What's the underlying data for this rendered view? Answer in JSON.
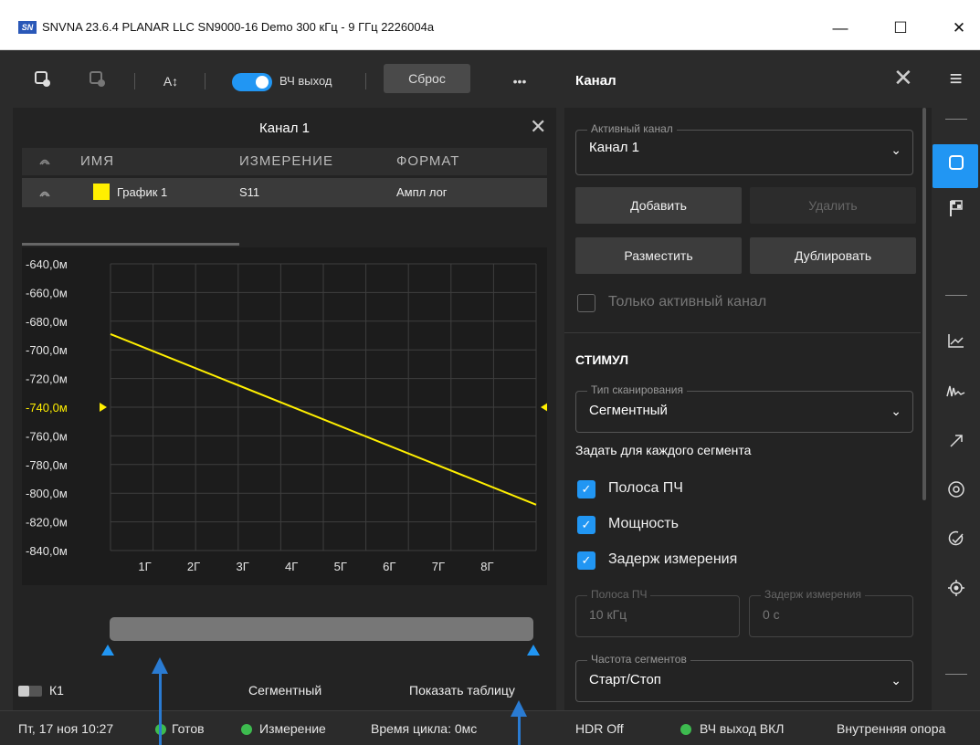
{
  "window": {
    "logo": "SN",
    "title": "SNVNA 23.6.4 PLANAR LLC SN9000-16 Demo 300 кГц - 9 ГГц 2226004a",
    "minimize": "—",
    "maximize": "☐",
    "close": "✕"
  },
  "toolbar": {
    "a_label": "A↕",
    "rf_out_label": "ВЧ выход",
    "reset_label": "Сброс",
    "more_label": "•••"
  },
  "channel_panel": {
    "title": "Канал 1",
    "close": "✕",
    "headers": [
      "ИМЯ",
      "ИЗМЕРЕНИЕ",
      "ФОРМАТ"
    ],
    "trace": {
      "name": "График 1",
      "measurement": "S11",
      "format": "Ампл лог",
      "color": "#ffef00"
    }
  },
  "chart_data": {
    "type": "line",
    "title": "",
    "xlabel": "",
    "ylabel": "",
    "y_tick_labels": [
      "-640,0м",
      "-660,0м",
      "-680,0м",
      "-700,0м",
      "-720,0м",
      "-740,0м",
      "-760,0м",
      "-780,0м",
      "-800,0м",
      "-820,0м",
      "-840,0м"
    ],
    "x_tick_labels": [
      "1Г",
      "2Г",
      "3Г",
      "4Г",
      "5Г",
      "6Г",
      "7Г",
      "8Г"
    ],
    "ylim": [
      -840,
      -640
    ],
    "reference_level": -740,
    "series": [
      {
        "color": "#ffef00",
        "x": [
          0.3,
          9
        ],
        "y": [
          -689,
          -808
        ]
      }
    ],
    "xlim": [
      0.3,
      9
    ],
    "grid": true
  },
  "bottom": {
    "channel_label": "К1",
    "sweep_type": "Сегментный",
    "show_table": "Показать таблицу"
  },
  "status_bar": {
    "datetime": "Пт, 17 ноя 10:27",
    "ready": "Готов",
    "measurement": "Измерение",
    "cycle_time": "Время цикла: 0мс",
    "hdr": "HDR Off",
    "rf_on": "ВЧ выход ВКЛ",
    "ref": "Внутренняя опора"
  },
  "right_panel": {
    "title": "Канал",
    "close": "✕",
    "active_channel_label": "Активный канал",
    "active_channel_value": "Канал 1",
    "add": "Добавить",
    "delete": "Удалить",
    "arrange": "Разместить",
    "duplicate": "Дублировать",
    "only_active": "Только активный канал",
    "stimulus_header": "СТИМУЛ",
    "scan_type_label": "Тип сканирования",
    "scan_type_value": "Сегментный",
    "per_segment_header": "Задать для каждого сегмента",
    "cb_ifbw": "Полоса ПЧ",
    "cb_power": "Мощность",
    "cb_delay": "Задерж измерения",
    "ifbw_label": "Полоса ПЧ",
    "ifbw_value": "10 кГц",
    "delay_label": "Задерж измерения",
    "delay_value": "0 с",
    "seg_freq_label": "Частота сегментов",
    "seg_freq_value": "Старт/Стоп",
    "chevron": "⌄",
    "check": "✓"
  },
  "sidebar": {
    "menu": "≡"
  }
}
